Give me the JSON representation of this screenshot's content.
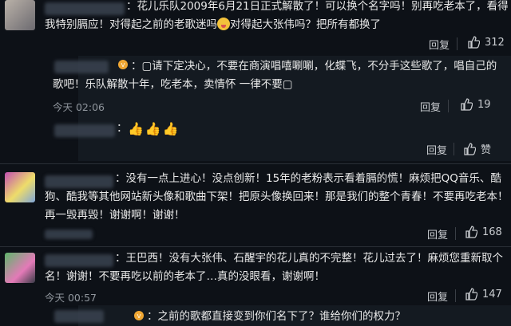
{
  "comments": [
    {
      "text_lines": [
        "：花儿乐队2009年6月21日正式解散了！可以换个名字吗！别再吃老本了，看得",
        "我特别膈应！对得起之前的老歌迷吗",
        "对得起大张伟吗？把所有都换了"
      ],
      "reply_label": "回复",
      "likes": "312"
    },
    {
      "text_lines": [
        "：▢请下定决心，不要在商演唱嘻唰唰，化蝶飞，不分手这些歌了，唱自己的",
        "歌吧！乐队解散十年，吃老本，卖情怀 一律不要▢"
      ],
      "time": "今天 02:06",
      "reply_label": "回复",
      "likes": "19"
    },
    {
      "text_lines": [
        "："
      ],
      "reply_label": "回复",
      "likes": "赞"
    },
    {
      "text_lines": [
        "：没有一点上进心！没点创新！15年的老粉表示看着膈的慌！麻烦把QQ音乐、酷",
        "狗、酷我等其他网站新头像和歌曲下架！把原头像换回来！那是我们的整个青春！不要再吃老本！",
        "再一毁再毁！谢谢啊！谢谢！"
      ],
      "reply_label": "回复",
      "likes": "168"
    },
    {
      "text_lines": [
        "：王巴西！没有大张伟、石醒宇的花儿真的不完整！花儿过去了！麻烦您重新取个",
        "名！谢谢！不要再吃以前的老本了…真的没眼看，谢谢啊！"
      ],
      "time": "今天 00:57",
      "reply_label": "回复",
      "likes": "147"
    },
    {
      "text_lines": [
        "：之前的歌都直接变到你们名下了？谁给你们的权力？"
      ]
    }
  ],
  "colors": {
    "background": "#0d1117",
    "text": "#e9e9e9",
    "muted": "#8f959c"
  },
  "icons": [
    "thumbs-up-icon",
    "vip-badge-icon",
    "emoji-icon"
  ]
}
